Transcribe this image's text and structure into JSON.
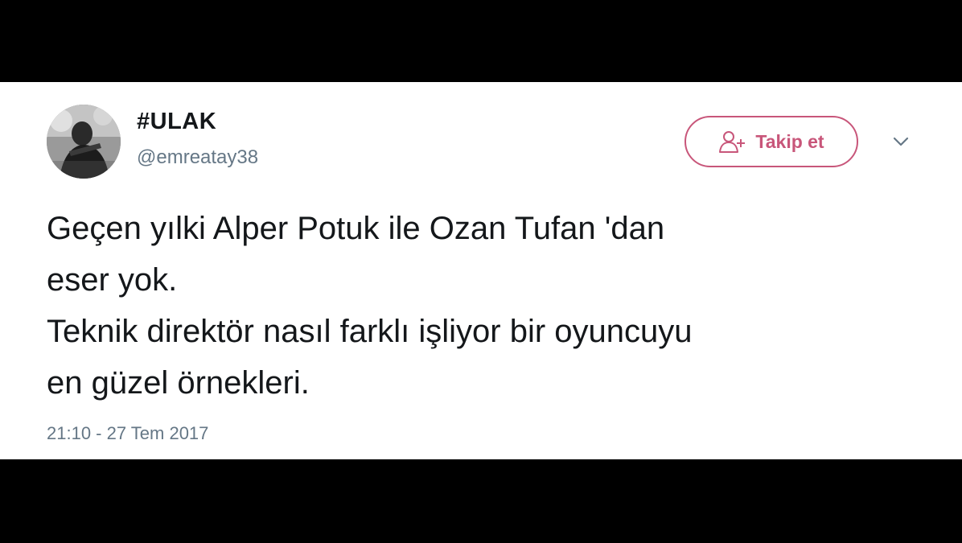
{
  "tweet": {
    "author": {
      "display_name": "#ULAK",
      "handle": "@emreatay38",
      "avatar_icon": "profile-photo"
    },
    "follow_button": {
      "label": "Takip et",
      "icon": "add-user-icon"
    },
    "more_menu_icon": "chevron-down-icon",
    "text_lines": [
      "Geçen yılki Alper Potuk ile Ozan Tufan 'dan",
      "eser yok.",
      "Teknik direktör nasıl farklı işliyor bir oyuncuyu",
      "en güzel örnekleri."
    ],
    "timestamp": "21:10 - 27 Tem 2017"
  },
  "colors": {
    "background": "#000000",
    "card": "#ffffff",
    "text": "#14171a",
    "muted": "#657786",
    "accent": "#c8567a"
  }
}
